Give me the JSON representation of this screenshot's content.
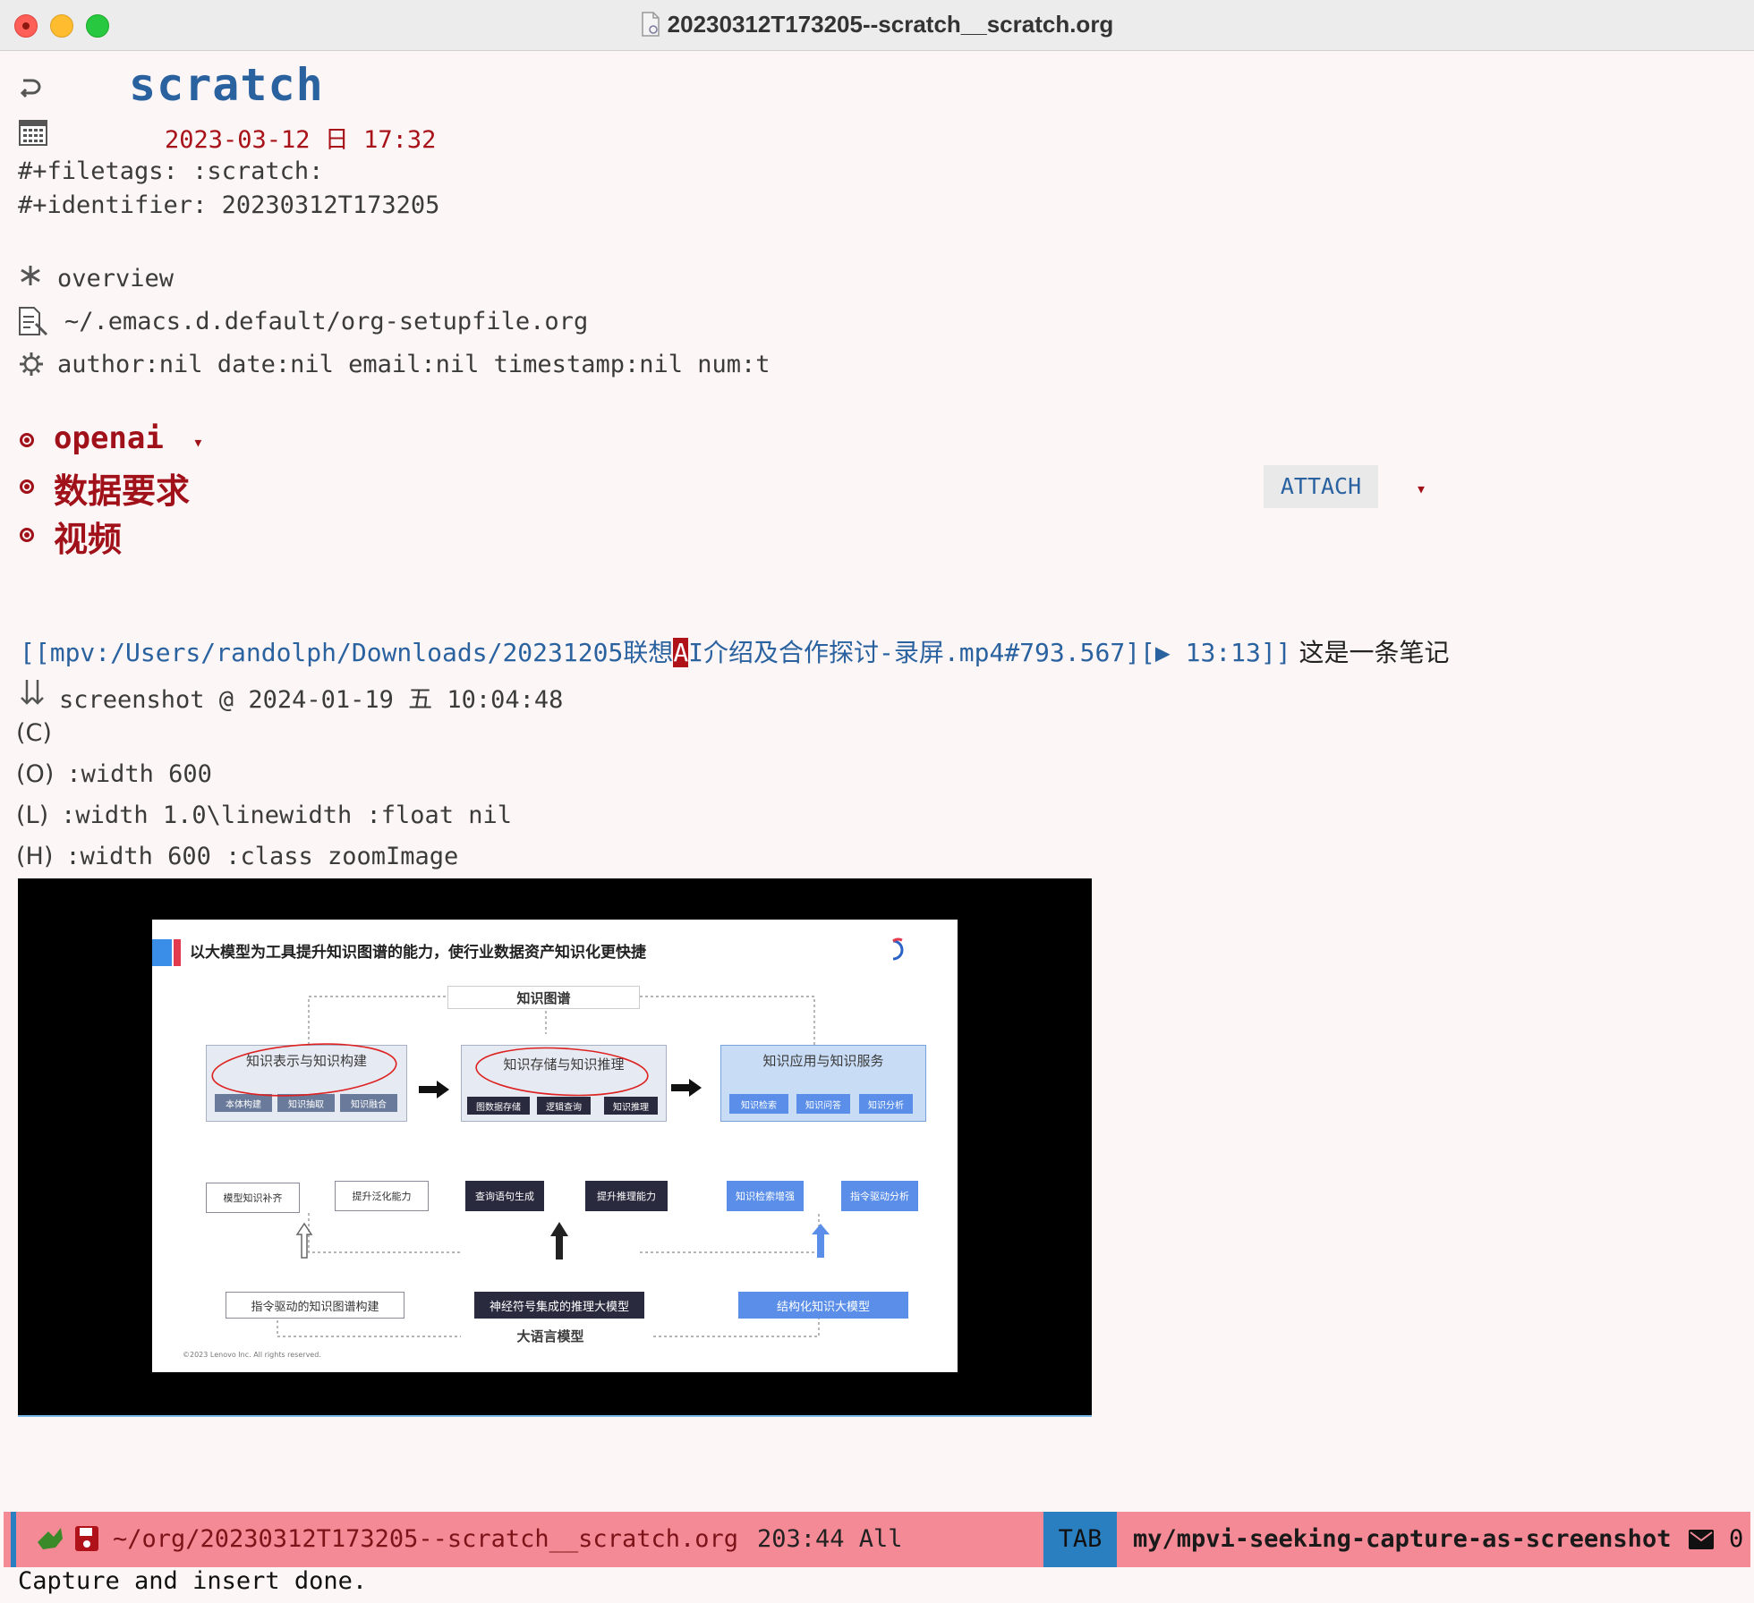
{
  "window": {
    "title": "20230312T173205--scratch__scratch.org"
  },
  "header": {
    "title": "scratch",
    "date": "2023-03-12 日  17:32",
    "filetags": "#+filetags:   :scratch:",
    "identifier": "#+identifier: 20230312T173205"
  },
  "keywords": {
    "startup": "overview",
    "setupfile": "~/.emacs.d.default/org-setupfile.org",
    "options": "author:nil date:nil email:nil timestamp:nil num:t"
  },
  "headings": [
    {
      "label": "openai",
      "fold": "▾"
    },
    {
      "label": "数据要求",
      "tag": "ATTACH",
      "fold": "▾"
    },
    {
      "label": "视频"
    }
  ],
  "link": {
    "before": "[[mpv:/Users/randolph/Downloads/20231205联想",
    "cursor_char": "A",
    "after": "I介绍及合作探讨-录屏.mp4#793.567][▶ 13:13]]",
    "note": " 这是一条笔记"
  },
  "screenshot": {
    "label": "screenshot @ 2024-01-19 五 10:04:48"
  },
  "attr_lines": [
    {
      "marker": "(C)",
      "text": ""
    },
    {
      "marker": "(O)",
      "text": ":width 600"
    },
    {
      "marker": "(L)",
      "text": ":width 1.0\\linewidth :float nil"
    },
    {
      "marker": "(H)",
      "text": ":width 600 :class zoomImage"
    }
  ],
  "slide": {
    "title": "以大模型为工具提升知识图谱的能力，使行业数据资产知识化更快捷",
    "top_label": "知识图谱",
    "bottom_label": "大语言模型",
    "col1": {
      "title": "知识表示与知识构建",
      "chips": [
        "本体构建",
        "知识抽取",
        "知识融合"
      ],
      "sub": [
        "模型知识补齐",
        "提升泛化能力"
      ],
      "base": "指令驱动的知识图谱构建"
    },
    "col2": {
      "title": "知识存储与知识推理",
      "chips": [
        "图数据存储",
        "逻辑查询",
        "知识推理"
      ],
      "sub": [
        "查询语句生成",
        "提升推理能力"
      ],
      "base": "神经符号集成的推理大模型"
    },
    "col3": {
      "title": "知识应用与知识服务",
      "chips": [
        "知识检索",
        "知识问答",
        "知识分析"
      ],
      "sub": [
        "知识检索增强",
        "指令驱动分析"
      ],
      "base": "结构化知识大模型"
    },
    "footer": "©2023 Lenovo Inc. All rights reserved."
  },
  "modeline": {
    "path": "~/org/20230312T173205--scratch__scratch.org",
    "position": "203:44 All",
    "tab": "TAB",
    "command": "my/mpvi-seeking-capture-as-screenshot",
    "mail_count": "0"
  },
  "echo_area": "Capture and insert done.",
  "colors": {
    "background": "#fdf6f6",
    "heading": "#a0111a",
    "link": "#2a62a0",
    "modeline": "#f48a96",
    "modeline_accent": "#2a7fc1"
  }
}
